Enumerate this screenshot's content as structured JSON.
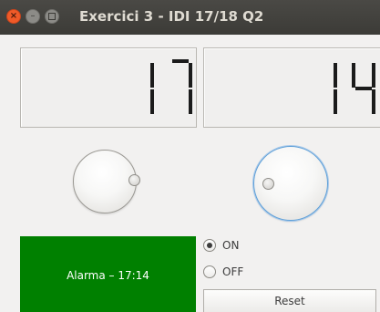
{
  "window": {
    "title": "Exercici 3 - IDI 17/18 Q2"
  },
  "displays": {
    "hours": "17",
    "minutes": "14"
  },
  "dials": {
    "hours_dial": {
      "focused": false
    },
    "minutes_dial": {
      "focused": true
    }
  },
  "alarm": {
    "label": "Alarma – 17:14",
    "background_color": "#008000"
  },
  "radios": {
    "on_label": "ON",
    "off_label": "OFF",
    "selected": "ON"
  },
  "buttons": {
    "reset_label": "Reset"
  }
}
